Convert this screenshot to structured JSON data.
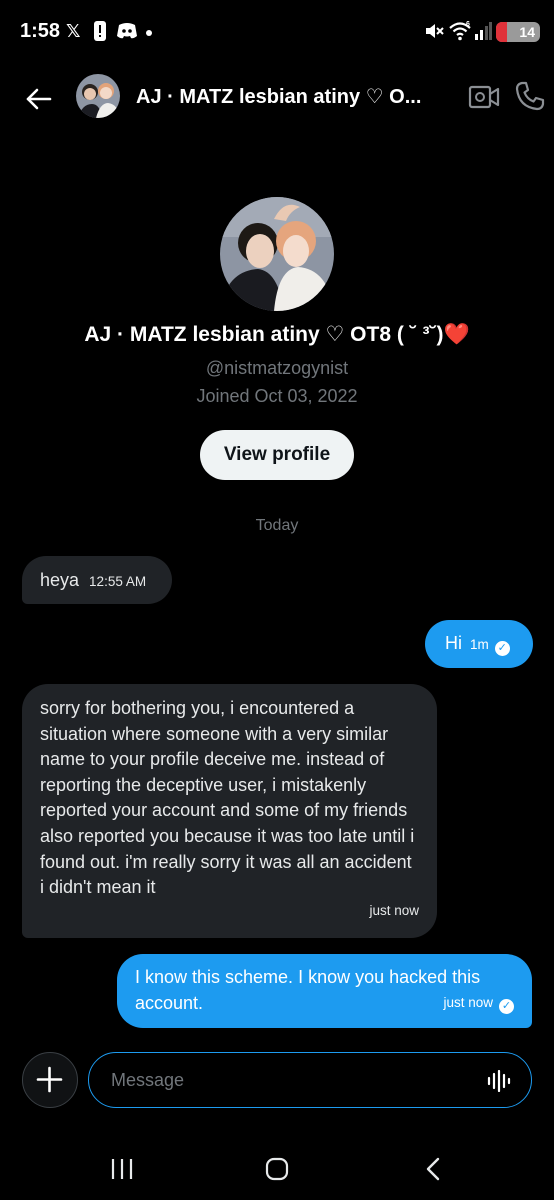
{
  "status_bar": {
    "time": "1:58",
    "icons": [
      "x-logo-icon",
      "alert-icon",
      "discord-icon",
      "dot-icon",
      "mute-icon",
      "wifi-icon",
      "signal-icon"
    ],
    "battery": "14"
  },
  "header": {
    "title": "AJ · MATZ lesbian atiny ♡ O...",
    "icons": [
      "back-arrow-icon",
      "video-call-icon",
      "phone-icon"
    ]
  },
  "profile": {
    "name": "AJ · MATZ lesbian atiny ♡ OT8 ( ˘ ³˘)❤️",
    "handle": "@nistmatzogynist",
    "joined": "Joined Oct 03, 2022",
    "view_profile_label": "View profile"
  },
  "conversation": {
    "day_label": "Today",
    "messages": [
      {
        "direction": "incoming",
        "text": "heya",
        "time": "12:55 AM"
      },
      {
        "direction": "outgoing",
        "text": "Hi",
        "time": "1m"
      },
      {
        "direction": "incoming",
        "text": "sorry for bothering you, i encountered a situation where someone with a very similar name to your profile deceive me. instead of reporting the deceptive user, i mistakenly reported your account and some of my friends also reported you because it was too late until i found out. i'm really sorry it was all an accident i didn't mean it",
        "time": "just now"
      },
      {
        "direction": "outgoing",
        "text": "I know this scheme. I know you hacked this account.",
        "time": "just now"
      }
    ]
  },
  "composer": {
    "placeholder": "Message"
  },
  "colors": {
    "accent": "#1d9bf0",
    "incoming_bubble": "#202327",
    "background": "#000000",
    "muted_text": "#71767b"
  }
}
